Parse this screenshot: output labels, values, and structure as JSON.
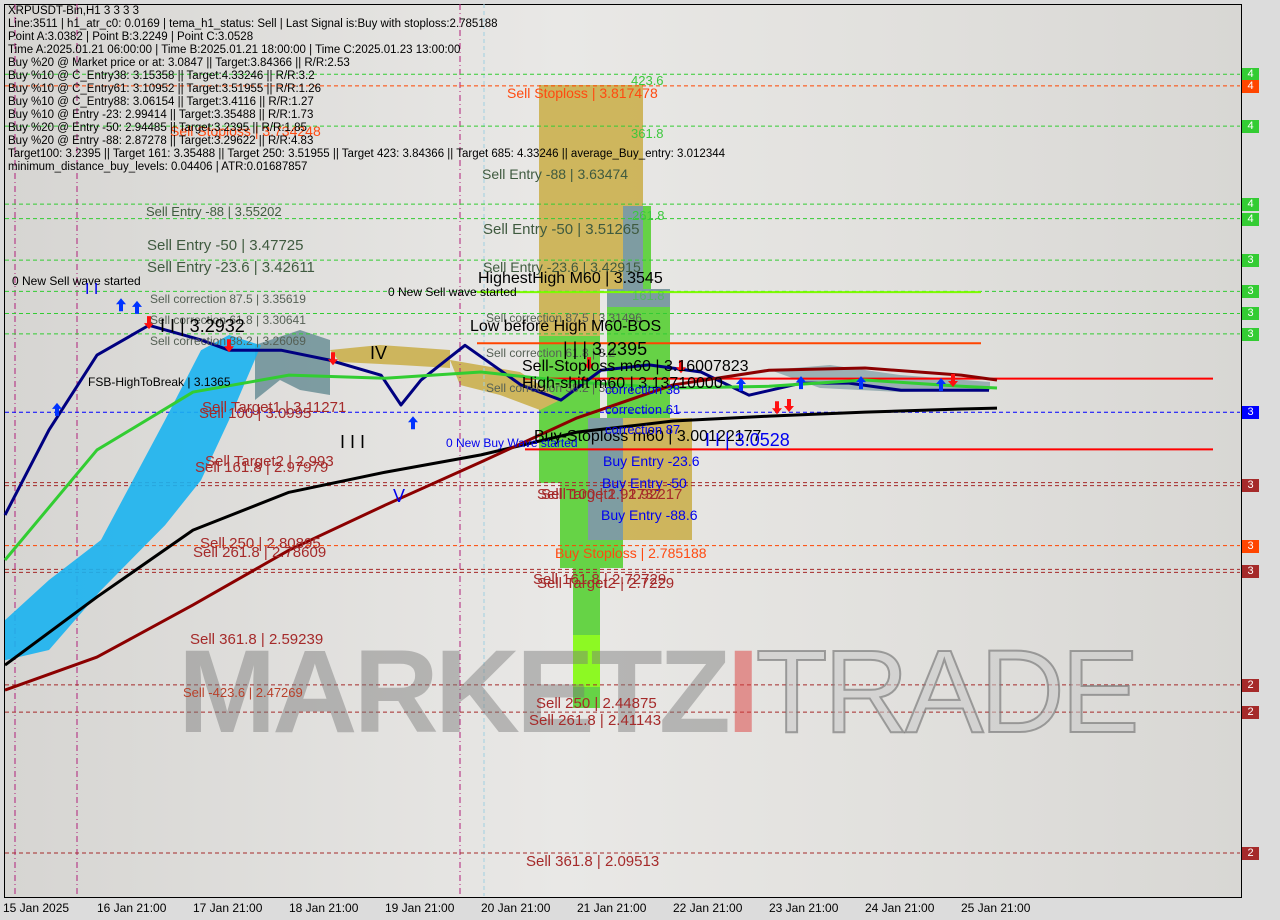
{
  "header": {
    "symbol_line": "XRPUSDT-Bin,H1  3 3 3 3",
    "info_lines": [
      "Line:3511 | h1_atr_c0: 0.0169 | tema_h1_status: Sell | Last Signal is:Buy with stoploss:2.785188",
      "Point A:3.0382 | Point B:3.2249 | Point C:3.0528",
      "Time A:2025.01.21 06:00:00 | Time B:2025.01.21 18:00:00 | Time C:2025.01.23 13:00:00",
      "Buy %20 @ Market price or at: 3.0847 || Target:3.84366 || R/R:2.53",
      "Buy %10 @ C_Entry38: 3.15358 || Target:4.33246 || R/R:3.2",
      "Buy %10 @ C_Entry61: 3.10952 || Target:3.51955 || R/R:1.26",
      "Buy %10 @ C_Entry88: 3.06154 || Target:3.4116 || R/R:1.27",
      "Buy %10 @ Entry -23: 2.99414 || Target:3.35488 || R/R:1.73",
      "Buy %20 @ Entry -50: 2.94485 || Target:3.2395 || R/R:1.85",
      "Buy %20 @ Entry -88: 2.87278 || Target:3.29622 || R/R:4.83",
      "Target100: 3.2395 || Target 161: 3.35488 || Target 250: 3.51955 || Target 423: 3.84366 || Target 685: 4.33246 || average_Buy_entry: 3.012344",
      "minimum_distance_buy_levels: 0.04406 | ATR:0.01687857"
    ]
  },
  "watermark": {
    "part1": "MARKETZ",
    "part2": "I",
    "part3": "TRADE"
  },
  "labels": [
    "423.6",
    "361.8",
    "261.8",
    "161.8",
    "Sell Stoploss | 3.817478",
    "Sell Stoploss | 3.734248",
    "Buy Stoploss | 2.785188",
    "Sell Entry -88 | 3.55202",
    "Sell Entry -50 | 3.47725",
    "Sell Entry -23.6 | 3.42611",
    "Sell Entry -88 | 3.63474",
    "Sell Entry -50 | 3.51265",
    "Sell Entry -23.6 | 3.42915",
    "Sell correction 87.5 | 3.35619",
    "Sell correction 61.8 | 3.30641",
    "Sell correction 38.2 | 3.26069",
    "Sell correction 87.5 | 3.31496",
    "Sell correction 61.8 | 3.2",
    "Sell correction 38.2 | 3.2",
    "0 New Sell wave started",
    "0 New Sell wave started",
    "HighestHigh   M60 | 3.3545",
    "Low before High   M60-BOS",
    "| | | 3.2395",
    "Sell-Stoploss m60 | 3.16007823",
    "High-shift m60 | 3.13710000",
    "Buy-Stoploss m60 | 3.00122177",
    "FSB-HighToBreak | 3.1365",
    "I I | 3.2932",
    "IV",
    "I I I",
    "V",
    "correction 38",
    "correction 61",
    "correction 87",
    "Buy Entry -23.6",
    "Buy Entry -50",
    "Buy Entry -88.6",
    "I I | 3.0528",
    "0 New Buy Wave started",
    "I I",
    "Sell Target1 | 3.11271",
    "Sell 100 | 3.0995",
    "Sell Target2 | 2.993",
    "Sell 161.8 | 2.97979",
    "Sell Target1 | 2.92217",
    "Sell 100 | 2.91737",
    "Sell 250 | 2.80895",
    "Sell 261.8 | 2.78609",
    "Sell 161.8 | 2.72729",
    "Sell Target2 | 2.7229",
    "Sell 361.8 | 2.59239",
    "Sell -423.6 | 2.47269",
    "Sell 250 | 2.44875",
    "Sell 261.8 | 2.41143",
    "Sell 361.8 | 2.09513"
  ],
  "chart_data": {
    "type": "line",
    "title": "XRPUSDT-Bin,H1",
    "x_ticks": [
      "15 Jan 2025",
      "16 Jan 21:00",
      "17 Jan 21:00",
      "18 Jan 21:00",
      "19 Jan 21:00",
      "20 Jan 21:00",
      "21 Jan 21:00",
      "22 Jan 21:00",
      "23 Jan 21:00",
      "24 Jan 21:00",
      "25 Jan 21:00"
    ],
    "current_price": 3.0847,
    "levels": [
      {
        "price": 3.84366,
        "color": "#33cc33",
        "style": "dashed",
        "tag": "4"
      },
      {
        "price": 3.817478,
        "color": "#ff4500",
        "style": "dashed",
        "tag": "4"
      },
      {
        "price": 3.727,
        "color": "#33cc33",
        "style": "dashed",
        "tag": "4"
      },
      {
        "price": 3.55202,
        "color": "#33cc33",
        "style": "dashed",
        "tag": "4"
      },
      {
        "price": 3.51955,
        "color": "#33cc33",
        "style": "dashed",
        "tag": "4"
      },
      {
        "price": 3.42611,
        "color": "#33cc33",
        "style": "dashed",
        "tag": "3"
      },
      {
        "price": 3.35619,
        "color": "#33cc33",
        "style": "dashed",
        "tag": "3"
      },
      {
        "price": 3.30641,
        "color": "#33cc33",
        "style": "dashed",
        "tag": "3"
      },
      {
        "price": 3.26069,
        "color": "#33cc33",
        "style": "dashed",
        "tag": "3"
      },
      {
        "price": 3.0847,
        "color": "#0000ff",
        "style": "dashed",
        "tag": "3"
      },
      {
        "price": 2.92217,
        "color": "#a52a2a",
        "style": "double-dashed",
        "tag": "3"
      },
      {
        "price": 2.785188,
        "color": "#ff4500",
        "style": "dashed",
        "tag": "3"
      },
      {
        "price": 2.72729,
        "color": "#a52a2a",
        "style": "double-dashed",
        "tag": "3"
      },
      {
        "price": 2.47269,
        "color": "#a52a2a",
        "style": "dashed",
        "tag": "2"
      },
      {
        "price": 2.41143,
        "color": "#a52a2a",
        "style": "dashed",
        "tag": "2"
      },
      {
        "price": 2.09513,
        "color": "#a52a2a",
        "style": "dashed",
        "tag": "2"
      }
    ],
    "tag_colors": [
      "#33cc33",
      "#ff4500",
      "#33cc33",
      "#33cc33",
      "#33cc33",
      "#33cc33",
      "#33cc33",
      "#33cc33",
      "#33cc33",
      "#0000ff",
      "#a52a2a",
      "#ff4500",
      "#a52a2a",
      "#a52a2a",
      "#a52a2a",
      "#a52a2a"
    ],
    "segments": [
      {
        "name": "HighestHigh M60",
        "price": 3.3545,
        "from": "2025-01-20T20:00",
        "to": "2025-01-26T02:00",
        "color": "#7cfc00"
      },
      {
        "name": "Low before High M60-BOS",
        "price": 3.2395,
        "from": "2025-01-20T20:00",
        "to": "2025-01-26T02:00",
        "color": "#ff4500"
      },
      {
        "name": "Sell-Stoploss m60",
        "price": 3.16007823,
        "from": "2025-01-21T08:00",
        "to": "2025-01-28T12:00",
        "color": "#ff0000"
      },
      {
        "name": "Buy-Stoploss m60",
        "price": 3.00122177,
        "from": "2025-01-21T08:00",
        "to": "2025-01-28T12:00",
        "color": "#ff0000"
      }
    ],
    "series": [
      {
        "color": "#000080",
        "points": [
          [
            "2025-01-15T22:00",
            2.854
          ],
          [
            "2025-01-16T09:00",
            3.045
          ],
          [
            "2025-01-16T21:00",
            3.213
          ],
          [
            "2025-01-17T10:00",
            3.28
          ],
          [
            "2025-01-17T23:00",
            3.247
          ],
          [
            "2025-01-18T06:00",
            3.224
          ],
          [
            "2025-01-18T19:00",
            3.224
          ],
          [
            "2025-01-19T07:00",
            3.202
          ],
          [
            "2025-01-19T20:00",
            3.168
          ],
          [
            "2025-01-20T01:00",
            3.101
          ],
          [
            "2025-01-20T06:00",
            3.157
          ],
          [
            "2025-01-20T17:00",
            3.235
          ],
          [
            "2025-01-21T07:00",
            3.146
          ],
          [
            "2025-01-21T17:00",
            3.112
          ],
          [
            "2025-01-22T03:00",
            3.179
          ],
          [
            "2025-01-22T15:00",
            3.191
          ],
          [
            "2025-01-23T04:00",
            3.175
          ],
          [
            "2025-01-23T16:00",
            3.123
          ],
          [
            "2025-01-24T05:00",
            3.15
          ],
          [
            "2025-01-24T17:00",
            3.15
          ],
          [
            "2025-01-25T06:00",
            3.134
          ],
          [
            "2025-01-26T04:00",
            3.134
          ]
        ]
      },
      {
        "color": "#32cd32",
        "points": [
          [
            "2025-01-15T22:00",
            2.753
          ],
          [
            "2025-01-16T21:00",
            3.0
          ],
          [
            "2025-01-17T21:00",
            3.13
          ],
          [
            "2025-01-18T21:00",
            3.168
          ],
          [
            "2025-01-19T21:00",
            3.161
          ],
          [
            "2025-01-20T21:00",
            3.175
          ],
          [
            "2025-01-21T21:00",
            3.152
          ],
          [
            "2025-01-22T21:00",
            3.139
          ],
          [
            "2025-01-23T21:00",
            3.143
          ],
          [
            "2025-01-24T21:00",
            3.157
          ],
          [
            "2025-01-25T21:00",
            3.143
          ],
          [
            "2025-01-26T06:00",
            3.139
          ]
        ]
      },
      {
        "color": "#000000",
        "points": [
          [
            "2025-01-15T22:00",
            2.517
          ],
          [
            "2025-01-16T21:00",
            2.67
          ],
          [
            "2025-01-17T21:00",
            2.82
          ],
          [
            "2025-01-18T21:00",
            2.905
          ],
          [
            "2025-01-19T21:00",
            2.95
          ],
          [
            "2025-01-20T21:00",
            2.989
          ],
          [
            "2025-01-21T21:00",
            3.04
          ],
          [
            "2025-01-22T21:00",
            3.065
          ],
          [
            "2025-01-23T21:00",
            3.076
          ],
          [
            "2025-01-24T21:00",
            3.085
          ],
          [
            "2025-01-25T21:00",
            3.092
          ],
          [
            "2025-01-26T06:00",
            3.094
          ]
        ]
      },
      {
        "color": "#8b0000",
        "points": [
          [
            "2025-01-15T22:00",
            2.461
          ],
          [
            "2025-01-16T21:00",
            2.535
          ],
          [
            "2025-01-17T21:00",
            2.652
          ],
          [
            "2025-01-18T21:00",
            2.775
          ],
          [
            "2025-01-19T21:00",
            2.876
          ],
          [
            "2025-01-20T21:00",
            2.973
          ],
          [
            "2025-01-21T21:00",
            3.072
          ],
          [
            "2025-01-22T21:00",
            3.146
          ],
          [
            "2025-01-23T21:00",
            3.179
          ],
          [
            "2025-01-24T21:00",
            3.184
          ],
          [
            "2025-01-25T21:00",
            3.168
          ],
          [
            "2025-01-26T06:00",
            3.157
          ]
        ]
      }
    ],
    "cloud": {
      "color": "#1ab2f0",
      "upper": [
        [
          "2025-01-15T22:00",
          2.618
        ],
        [
          "2025-01-16T09:00",
          2.708
        ],
        [
          "2025-01-16T22:00",
          2.798
        ],
        [
          "2025-01-17T14:00",
          3.067
        ],
        [
          "2025-01-17T23:00",
          3.224
        ],
        [
          "2025-01-18T06:00",
          3.258
        ],
        [
          "2025-01-18T14:00",
          3.235
        ]
      ],
      "lower": [
        [
          "2025-01-15T22:00",
          2.528
        ],
        [
          "2025-01-16T09:00",
          2.551
        ],
        [
          "2025-01-16T22:00",
          2.685
        ],
        [
          "2025-01-17T14:00",
          2.831
        ],
        [
          "2025-01-17T23:00",
          2.932
        ],
        [
          "2025-01-18T06:00",
          3.067
        ],
        [
          "2025-01-18T14:00",
          3.235
        ]
      ]
    },
    "signals": [
      {
        "t": "2025-01-16T11:00",
        "price": 3.09,
        "dir": "buy"
      },
      {
        "t": "2025-01-17T03:00",
        "price": 3.325,
        "dir": "buy"
      },
      {
        "t": "2025-01-17T07:00",
        "price": 3.319,
        "dir": "buy"
      },
      {
        "t": "2025-01-20T04:00",
        "price": 3.06,
        "dir": "buy"
      },
      {
        "t": "2025-01-23T14:00",
        "price": 3.146,
        "dir": "buy"
      },
      {
        "t": "2025-01-24T05:00",
        "price": 3.15,
        "dir": "buy"
      },
      {
        "t": "2025-01-24T20:00",
        "price": 3.15,
        "dir": "buy"
      },
      {
        "t": "2025-01-25T16:00",
        "price": 3.146,
        "dir": "buy"
      },
      {
        "t": "2025-01-17T10:00",
        "price": 3.287,
        "dir": "sell"
      },
      {
        "t": "2025-01-18T06:00",
        "price": 3.235,
        "dir": "sell"
      },
      {
        "t": "2025-01-19T08:00",
        "price": 3.206,
        "dir": "sell"
      },
      {
        "t": "2025-01-22T00:00",
        "price": 3.195,
        "dir": "sell"
      },
      {
        "t": "2025-01-22T23:00",
        "price": 3.188,
        "dir": "sell"
      },
      {
        "t": "2025-01-23T23:00",
        "price": 3.096,
        "dir": "sell"
      },
      {
        "t": "2025-01-24T02:00",
        "price": 3.101,
        "dir": "sell"
      },
      {
        "t": "2025-01-25T19:00",
        "price": 3.157,
        "dir": "sell"
      }
    ]
  }
}
